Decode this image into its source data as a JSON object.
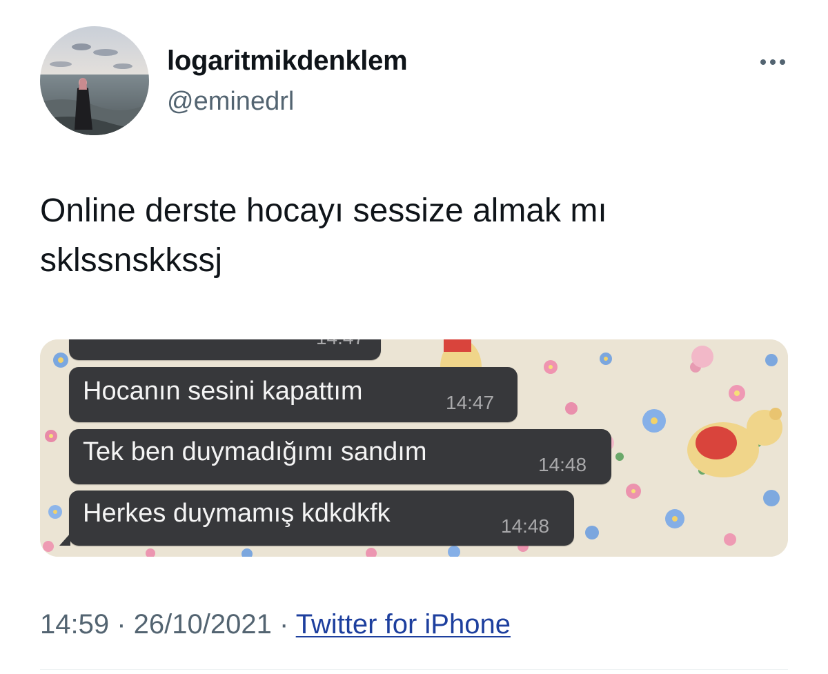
{
  "user": {
    "display_name": "logaritmikdenklem",
    "handle": "@eminedrl"
  },
  "tweet": {
    "text_lines": [
      "Online derste hocayı sessize almak mı",
      "sklssnskkssj"
    ]
  },
  "media": {
    "messages": [
      {
        "text": "",
        "time": "14:47"
      },
      {
        "text": "Hocanın sesini kapattım",
        "time": "14:47"
      },
      {
        "text": "Tek ben duymadığımı  sandım",
        "time": "14:48"
      },
      {
        "text": "Herkes duymamış kdkdkfk",
        "time": "14:48"
      }
    ]
  },
  "meta": {
    "time": "14:59",
    "separator_1": " · ",
    "date": "26/10/2021",
    "separator_2": " · ",
    "source": "Twitter for iPhone"
  },
  "colors": {
    "text": "#0f1419",
    "secondary": "#536471",
    "link": "#1d3f9e",
    "bubble": "#37383b"
  },
  "icons": {
    "more": "more-horizontal-icon"
  }
}
